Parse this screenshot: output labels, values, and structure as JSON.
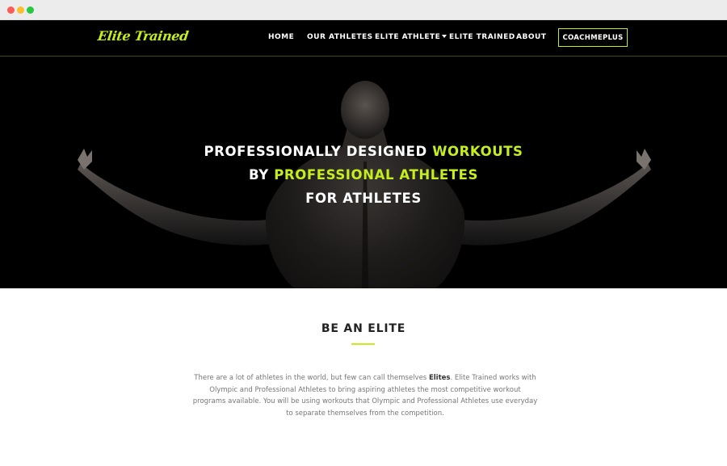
{
  "nav": {
    "brand": "Elite Trained",
    "items": [
      {
        "label": "HOME"
      },
      {
        "label": "OUR ATHLETES"
      },
      {
        "label": "ELITE ATHLETE",
        "has_dropdown": true
      },
      {
        "label": "ELITE TRAINED"
      },
      {
        "label": "ABOUT"
      }
    ],
    "cta": "COACHMEPLUS"
  },
  "hero": {
    "line1": {
      "prefix": "PROFESSIONALLY DESIGNED ",
      "highlight": "WORKOUTS"
    },
    "line2": {
      "prefix": "BY ",
      "highlight": "PROFESSIONAL ATHLETES"
    },
    "line3": "FOR ATHLETES"
  },
  "section": {
    "title": "BE AN ELITE",
    "body_before": "There are a lot of athletes in the world, but few can call themselves ",
    "body_bold": "Elites",
    "body_after": ". Elite Trained works with Olympic and Professional Athletes to bring aspiring athletes the most competitive workout programs available. You will be using workouts that Olympic and Professional Athletes use everyday to separate themselves from the competition."
  },
  "colors": {
    "accent": "#c6ee1d",
    "nav_background": "#000000",
    "hero_background": "#000000"
  }
}
